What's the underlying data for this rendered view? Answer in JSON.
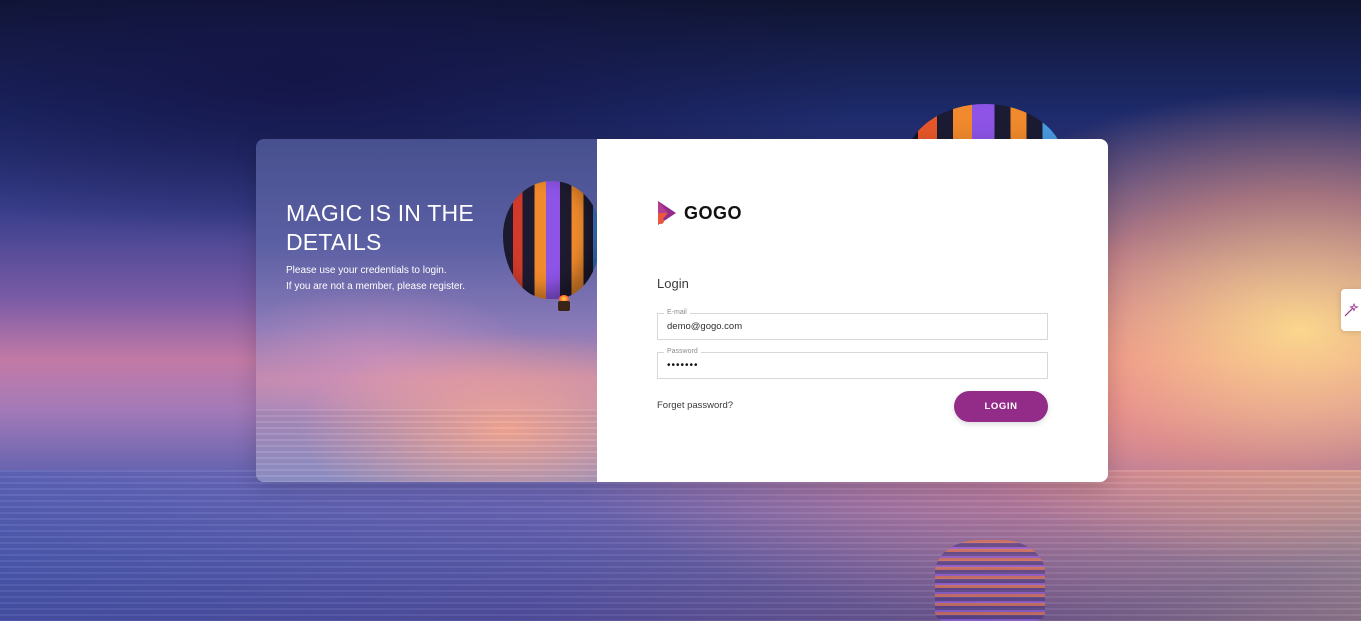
{
  "intro": {
    "heading": "MAGIC IS IN THE DETAILS",
    "line1": "Please use your credentials to login.",
    "line2": "If you are not a member, please register."
  },
  "brand": {
    "name": "GOGO",
    "logo_icon": "gogo-logo-icon",
    "colors": [
      "#922c88",
      "#e8573f",
      "#b53e93"
    ]
  },
  "form": {
    "title": "Login",
    "email": {
      "label": "E-mail",
      "value": "demo@gogo.com"
    },
    "password": {
      "label": "Password",
      "value": "•••••••"
    },
    "forgot_label": "Forget password?",
    "login_label": "LOGIN"
  },
  "theme": {
    "accent": "#922c88",
    "settings_icon": "magic-wand-icon"
  }
}
